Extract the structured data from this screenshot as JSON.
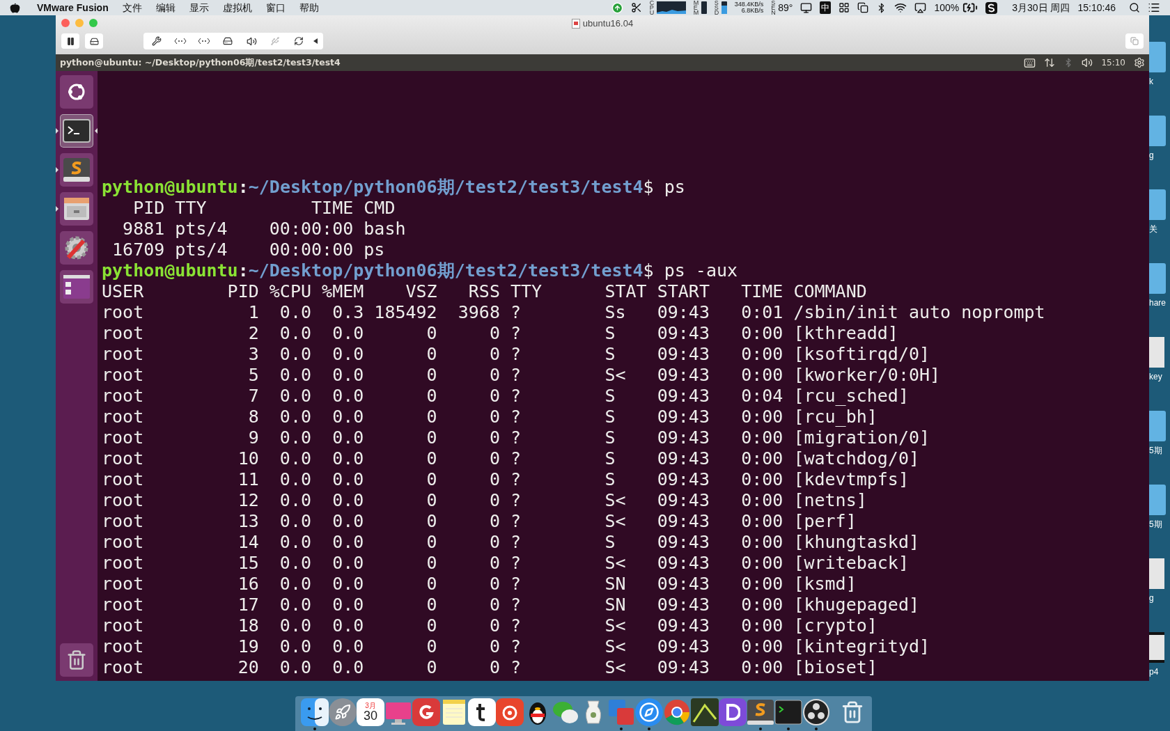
{
  "menu_bar": {
    "app_name": "VMware Fusion",
    "menus": [
      "文件",
      "编辑",
      "显示",
      "虚拟机",
      "窗口",
      "帮助"
    ],
    "status": {
      "cpu_label": "CPU",
      "mem_label": "MEM",
      "ssd_label": "SSD",
      "upload": "348.4KB/s",
      "download": "6.8KB/s",
      "sen_label": "SEN",
      "temperature": "89°",
      "ime": "中",
      "battery": "100%",
      "date": "3月30日 周四",
      "time": "15:10:46"
    }
  },
  "window": {
    "title": "ubuntu16.04"
  },
  "ubuntu_panel": {
    "title": "python@ubuntu: ~/Desktop/python06期/test2/test3/test4",
    "time": "15:10"
  },
  "launcher": [
    {
      "kind": "ubuntu",
      "running": false,
      "focused": false
    },
    {
      "kind": "terminal",
      "running": true,
      "focused": true
    },
    {
      "kind": "sublime",
      "running": true,
      "focused": false
    },
    {
      "kind": "files",
      "running": true,
      "focused": false
    },
    {
      "kind": "settings",
      "running": false,
      "focused": false
    },
    {
      "kind": "workspaces",
      "running": false,
      "focused": false
    }
  ],
  "terminal": {
    "lines": [
      {
        "kind": "prompt",
        "user_host": "python@ubuntu",
        "separator": ":",
        "path": "~/Desktop/python06期/test2/test3/test4",
        "symbol": "$",
        "command": "ps"
      },
      {
        "kind": "output",
        "text": "   PID TTY          TIME CMD"
      },
      {
        "kind": "output",
        "text": "  9881 pts/4    00:00:00 bash"
      },
      {
        "kind": "output",
        "text": " 16709 pts/4    00:00:00 ps"
      },
      {
        "kind": "prompt",
        "user_host": "python@ubuntu",
        "separator": ":",
        "path": "~/Desktop/python06期/test2/test3/test4",
        "symbol": "$",
        "command": "ps -aux"
      },
      {
        "kind": "output",
        "text": "USER        PID %CPU %MEM    VSZ   RSS TTY      STAT START   TIME COMMAND"
      },
      {
        "kind": "output",
        "text": "root          1  0.0  0.3 185492  3968 ?        Ss   09:43   0:01 /sbin/init auto noprompt"
      },
      {
        "kind": "output",
        "text": "root          2  0.0  0.0      0     0 ?        S    09:43   0:00 [kthreadd]"
      },
      {
        "kind": "output",
        "text": "root          3  0.0  0.0      0     0 ?        S    09:43   0:00 [ksoftirqd/0]"
      },
      {
        "kind": "output",
        "text": "root          5  0.0  0.0      0     0 ?        S<   09:43   0:00 [kworker/0:0H]"
      },
      {
        "kind": "output",
        "text": "root          7  0.0  0.0      0     0 ?        S    09:43   0:04 [rcu_sched]"
      },
      {
        "kind": "output",
        "text": "root          8  0.0  0.0      0     0 ?        S    09:43   0:00 [rcu_bh]"
      },
      {
        "kind": "output",
        "text": "root          9  0.0  0.0      0     0 ?        S    09:43   0:00 [migration/0]"
      },
      {
        "kind": "output",
        "text": "root         10  0.0  0.0      0     0 ?        S    09:43   0:00 [watchdog/0]"
      },
      {
        "kind": "output",
        "text": "root         11  0.0  0.0      0     0 ?        S    09:43   0:00 [kdevtmpfs]"
      },
      {
        "kind": "output",
        "text": "root         12  0.0  0.0      0     0 ?        S<   09:43   0:00 [netns]"
      },
      {
        "kind": "output",
        "text": "root         13  0.0  0.0      0     0 ?        S<   09:43   0:00 [perf]"
      },
      {
        "kind": "output",
        "text": "root         14  0.0  0.0      0     0 ?        S    09:43   0:00 [khungtaskd]"
      },
      {
        "kind": "output",
        "text": "root         15  0.0  0.0      0     0 ?        S<   09:43   0:00 [writeback]"
      },
      {
        "kind": "output",
        "text": "root         16  0.0  0.0      0     0 ?        SN   09:43   0:00 [ksmd]"
      },
      {
        "kind": "output",
        "text": "root         17  0.0  0.0      0     0 ?        SN   09:43   0:00 [khugepaged]"
      },
      {
        "kind": "output",
        "text": "root         18  0.0  0.0      0     0 ?        S<   09:43   0:00 [crypto]"
      },
      {
        "kind": "output",
        "text": "root         19  0.0  0.0      0     0 ?        S<   09:43   0:00 [kintegrityd]"
      },
      {
        "kind": "output",
        "text": "root         20  0.0  0.0      0     0 ?        S<   09:43   0:00 [bioset]"
      }
    ]
  },
  "desktop_icons": [
    {
      "kind": "folder",
      "label": "k"
    },
    {
      "kind": "folder",
      "label": "g"
    },
    {
      "kind": "folder",
      "label": "关"
    },
    {
      "kind": "folder",
      "label": "hare"
    },
    {
      "kind": "file",
      "label": "key"
    },
    {
      "kind": "folder",
      "label": "5期"
    },
    {
      "kind": "folder",
      "label": "5期"
    },
    {
      "kind": "file",
      "label": "g"
    },
    {
      "kind": "video",
      "label": "p4"
    }
  ],
  "dock": [
    {
      "kind": "finder",
      "running": true
    },
    {
      "kind": "launchpad",
      "running": false
    },
    {
      "kind": "calendar",
      "running": false,
      "month": "3月",
      "day": "30"
    },
    {
      "kind": "imac",
      "running": false
    },
    {
      "kind": "g-app",
      "running": false
    },
    {
      "kind": "notes",
      "running": false
    },
    {
      "kind": "t-app",
      "running": false
    },
    {
      "kind": "music",
      "running": false
    },
    {
      "kind": "penguin",
      "running": false
    },
    {
      "kind": "chat",
      "running": false
    },
    {
      "kind": "vase",
      "running": false
    },
    {
      "kind": "vmware",
      "running": true
    },
    {
      "kind": "safari",
      "running": true
    },
    {
      "kind": "chrome",
      "running": false
    },
    {
      "kind": "photo",
      "running": false
    },
    {
      "kind": "d-app",
      "running": false
    },
    {
      "kind": "sublime",
      "running": true
    },
    {
      "kind": "terminal",
      "running": true
    },
    {
      "kind": "obs",
      "running": true
    },
    {
      "kind": "trash",
      "running": false
    }
  ]
}
